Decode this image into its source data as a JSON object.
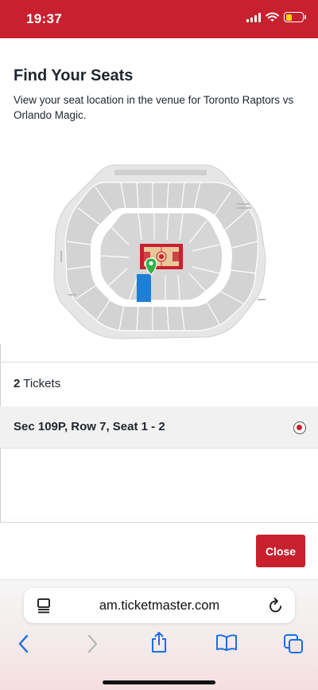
{
  "status_bar": {
    "time": "19:37",
    "battery_color": "#ffd60a"
  },
  "page": {
    "title": "Find Your Seats",
    "subtitle": "View your seat location in the venue for Toronto Raptors vs Orlando Magic."
  },
  "tickets": {
    "count": "2",
    "count_suffix": " Tickets",
    "selected_seat": "Sec 109P, Row 7, Seat 1 - 2",
    "selected": true
  },
  "actions": {
    "close_label": "Close"
  },
  "browser": {
    "url": "am.ticketmaster.com",
    "icons": [
      "reader-icon",
      "reload-icon",
      "back-icon",
      "forward-icon",
      "share-icon",
      "bookmarks-icon",
      "tabs-icon"
    ]
  },
  "colors": {
    "brand_red": "#c8202f",
    "seat_highlight": "#1f7fd6",
    "pin_green": "#2fb34a",
    "link_blue": "#1a6fe0"
  }
}
